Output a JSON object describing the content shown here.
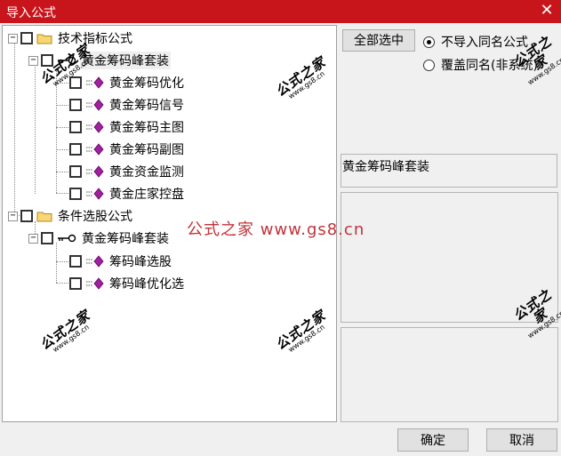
{
  "window": {
    "title": "导入公式",
    "close_glyph": "✕"
  },
  "tree": {
    "groups": [
      {
        "label": "技术指标公式",
        "suite": "黄金筹码峰套装",
        "items": [
          "黄金筹码优化",
          "黄金筹码信号",
          "黄金筹码主图",
          "黄金筹码副图",
          "黄金资金监测",
          "黄金庄家控盘"
        ]
      },
      {
        "label": "条件选股公式",
        "suite": "黄金筹码峰套装",
        "items": [
          "筹码峰选股",
          "筹码峰优化选"
        ]
      }
    ]
  },
  "right_panel": {
    "select_all_label": "全部选中",
    "radio_options": [
      {
        "label": "不导入同名公式",
        "checked": true
      },
      {
        "label": "覆盖同名(非系统)",
        "checked": false
      }
    ],
    "formula_name": "黄金筹码峰套装"
  },
  "buttons": {
    "ok_label": "确定",
    "cancel_label": "取消"
  },
  "watermark": {
    "stamp": "公式之家",
    "url": "www.gs8.cn",
    "center": "公式之家 www.gs8.cn"
  },
  "colors": {
    "titlebar": "#c8151b",
    "leaf_icon": "#a020a0",
    "center_watermark": "#c0343a"
  }
}
